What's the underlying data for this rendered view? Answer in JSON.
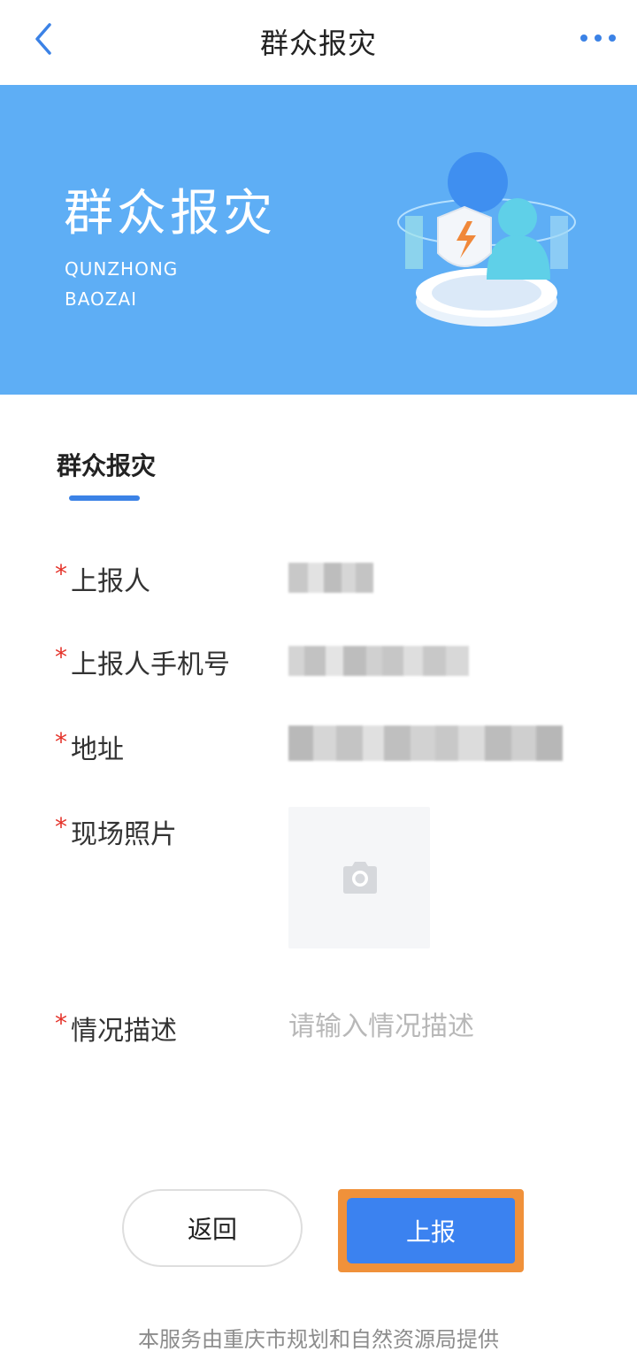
{
  "header": {
    "title": "群众报灾",
    "back_icon": "chevron-left-icon",
    "more_icon": "more-dots-icon"
  },
  "banner": {
    "title": "群众报灾",
    "subtitle": "QUNZHONG\nBAOZAI",
    "background": "#5eaef5"
  },
  "section": {
    "title": "群众报灾"
  },
  "form": {
    "reporter_label": "上报人",
    "phone_label": "上报人手机号",
    "address_label": "地址",
    "photo_label": "现场照片",
    "description_label": "情况描述",
    "description_placeholder": "请输入情况描述",
    "required_mark": "*"
  },
  "buttons": {
    "back_label": "返回",
    "submit_label": "上报"
  },
  "footer": {
    "text": "本服务由重庆市规划和自然资源局提供"
  },
  "colors": {
    "accent": "#3b82f0",
    "required": "#e5332a",
    "highlight": "#f0913a"
  }
}
